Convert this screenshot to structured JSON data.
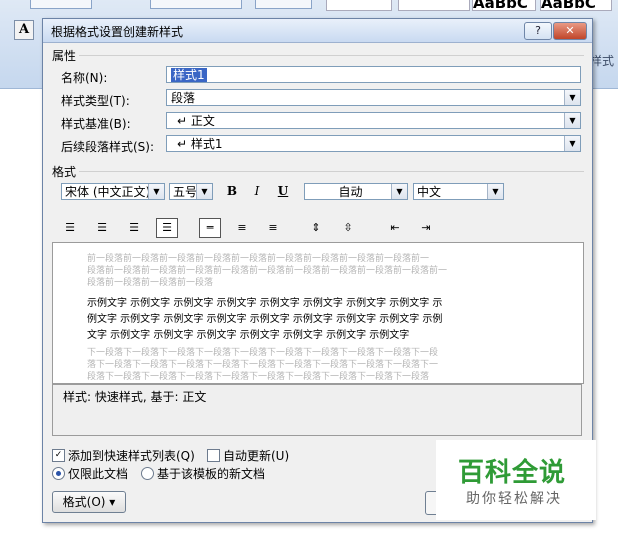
{
  "dialog": {
    "title": "根据格式设置创建新样式",
    "help": "?",
    "close": "✕"
  },
  "background": {
    "style_tiles": [
      "AaBbC",
      "AaBbC"
    ],
    "right_label": "样式"
  },
  "properties": {
    "section_label": "属性",
    "name_label": "名称(N):",
    "name_value": "样式1",
    "type_label": "样式类型(T):",
    "type_value": "段落",
    "based_label": "样式基准(B):",
    "based_value": "↵ 正文",
    "next_label": "后续段落样式(S):",
    "next_value": "↵ 样式1"
  },
  "format": {
    "section_label": "格式",
    "font": "宋体 (中文正文)",
    "size": "五号",
    "bold": "B",
    "italic": "I",
    "underline": "U",
    "color": "自动",
    "language": "中文"
  },
  "preview": {
    "before_lines": [
      "前一段落前一段落前一段落前一段落前一段落前一段落前一段落前一段落前一段落前一",
      "段落前一段落前一段落前一段落前一段落前一段落前一段落前一段落前一段落前一段落前一",
      "段落前一段落前一段落前一段落"
    ],
    "sample_lines": [
      "示例文字 示例文字 示例文字 示例文字 示例文字 示例文字 示例文字 示例文字 示",
      "例文字 示例文字 示例文字 示例文字 示例文字 示例文字 示例文字 示例文字 示例",
      "文字 示例文字 示例文字 示例文字 示例文字 示例文字 示例文字 示例文字"
    ],
    "after_lines": [
      "下一段落下一段落下一段落下一段落下一段落下一段落下一段落下一段落下一段落下一段",
      "落下一段落下一段落下一段落下一段落下一段落下一段落下一段落下一段落下一段落下一",
      "段落下一段落下一段落下一段落下一段落下一段落下一段落下一段落下一段落下一段落"
    ]
  },
  "description": "样式: 快速样式, 基于: 正文",
  "options": {
    "add_quick": "添加到快速样式列表(Q)",
    "auto_update": "自动更新(U)",
    "only_doc": "仅限此文档",
    "template_docs": "基于该模板的新文档"
  },
  "format_button": "格式(O) ▾",
  "watermark": {
    "title": "百科全说",
    "subtitle": "助你轻松解决"
  }
}
